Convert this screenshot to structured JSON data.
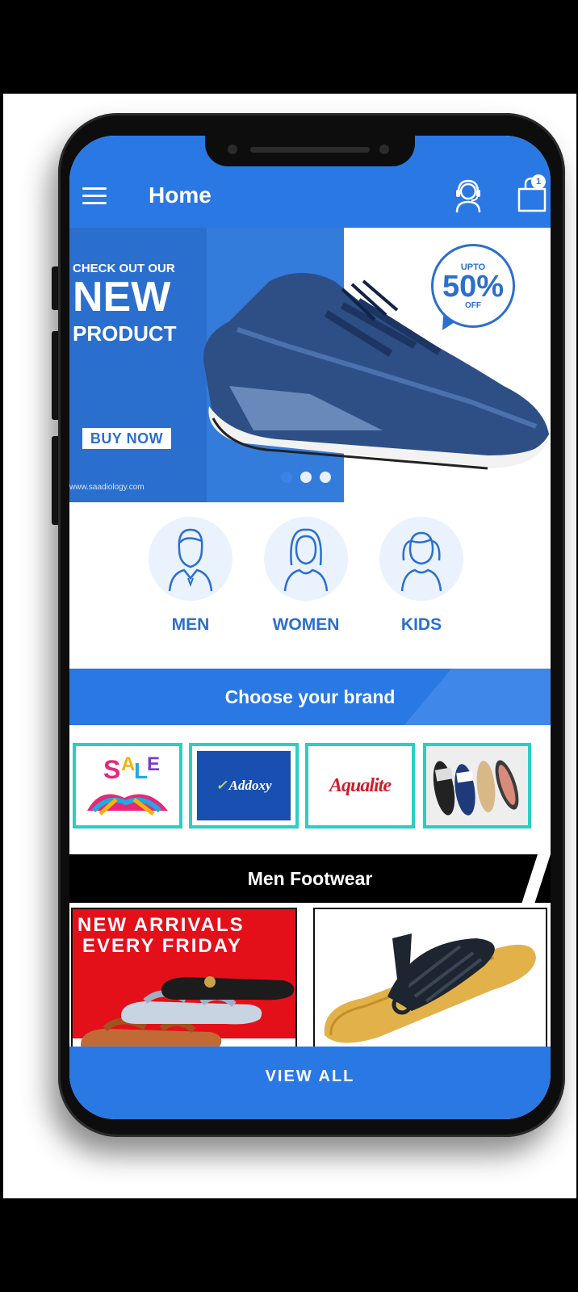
{
  "appbar": {
    "title": "Home",
    "cart_count": "1",
    "color": "#2a78e4"
  },
  "banner": {
    "line1": "CHECK OUT OUR",
    "line2": "NEW",
    "line3": "PRODUCT",
    "cta": "BUY NOW",
    "website": "www.saadiology.com",
    "offer_upto": "UPTO",
    "offer_value": "50%",
    "offer_off": "OFF",
    "slide_count": 3,
    "active_slide": 1
  },
  "categories": [
    {
      "label": "MEN",
      "icon": "man-avatar-icon"
    },
    {
      "label": "WOMEN",
      "icon": "woman-avatar-icon"
    },
    {
      "label": "KIDS",
      "icon": "kid-avatar-icon"
    }
  ],
  "brands": {
    "heading": "Choose your brand",
    "items": [
      {
        "name": "SALE"
      },
      {
        "name": "Addoxy"
      },
      {
        "name": "Aqualite"
      },
      {
        "name": "slippers"
      }
    ],
    "border_color": "#29cfc3"
  },
  "men_footwear": {
    "heading": "Men Footwear",
    "promo_line1": "NEW ARRIVALS",
    "promo_line2": "EVERY FRIDAY"
  },
  "footer": {
    "view_all": "VIEW ALL"
  }
}
